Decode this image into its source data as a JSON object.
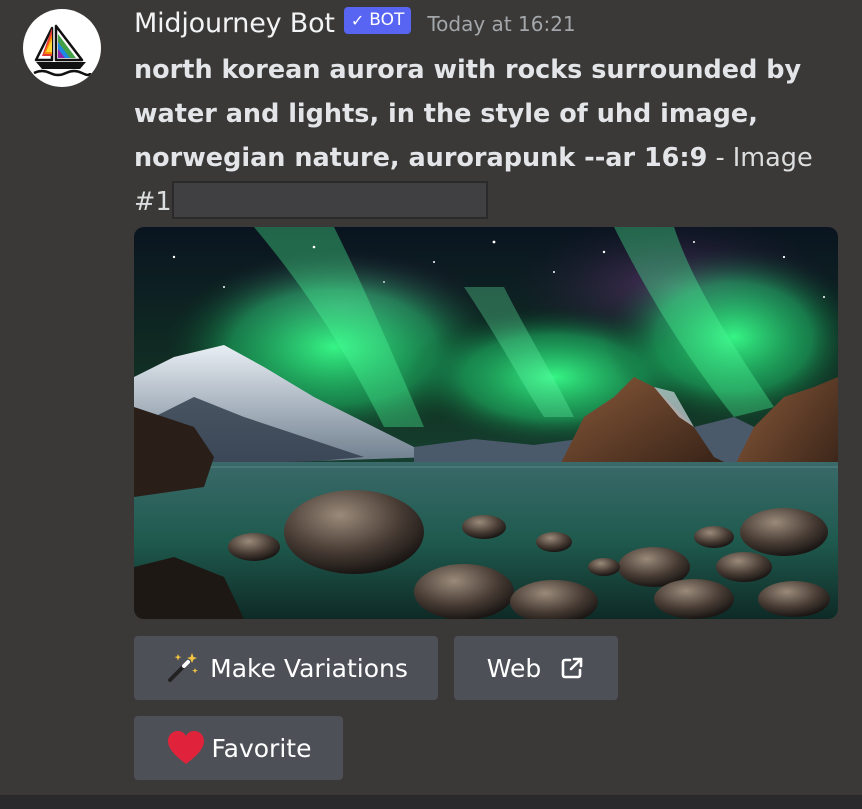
{
  "message": {
    "username": "Midjourney Bot",
    "bot_tag": "BOT",
    "bot_tag_check": "✓",
    "timestamp": "Today at 16:21",
    "prompt_bold": "north korean aurora with rocks surrounded by water and lights, in the style of uhd image, norwegian nature, aurorapunk --ar 16:9",
    "prompt_suffix": " - Image #1"
  },
  "image": {
    "alt": "Aurora borealis over rocky shoreline with snowy mountains"
  },
  "buttons": {
    "variations_label": "Make Variations",
    "variations_icon": "magic-wand-icon",
    "web_label": "Web",
    "web_icon": "external-link-icon",
    "favorite_label": "Favorite",
    "favorite_icon": "heart-icon"
  },
  "colors": {
    "background": "#3a3937",
    "bot_tag": "#5865f2",
    "button": "#4e5058",
    "heart": "#e0233a"
  }
}
